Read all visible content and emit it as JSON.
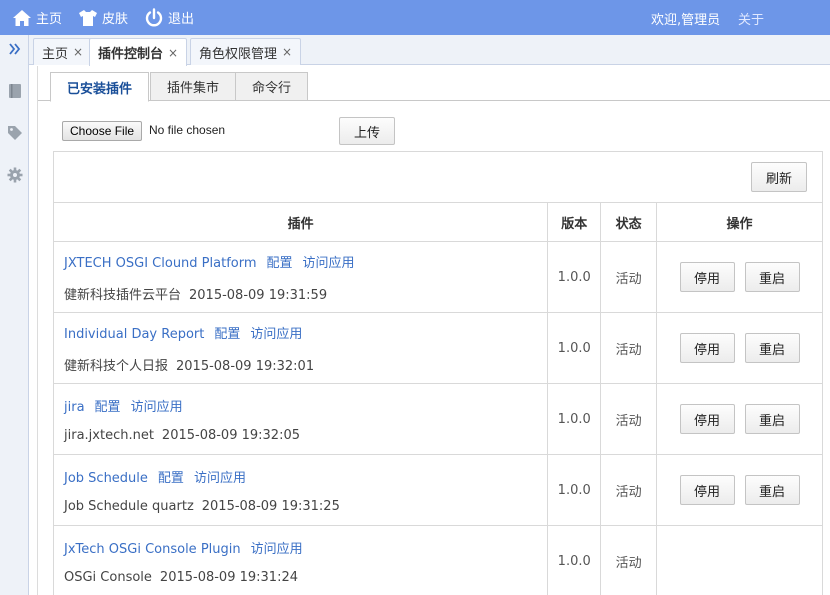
{
  "topbar": {
    "nav": [
      {
        "label": "主页",
        "icon": "home-icon"
      },
      {
        "label": "皮肤",
        "icon": "tshirt-icon"
      },
      {
        "label": "退出",
        "icon": "power-icon"
      }
    ],
    "welcome": "欢迎,管理员",
    "about": "关于",
    "bg_color": "#6d96e8"
  },
  "sidebar": {
    "icons": [
      "expand-chevrons-icon",
      "book-icon",
      "tag-icon",
      "gear-icon"
    ]
  },
  "page_tabs": [
    {
      "label": "主页",
      "close": "×",
      "active": false
    },
    {
      "label": "插件控制台",
      "close": "×",
      "active": true
    },
    {
      "label": "角色权限管理",
      "close": "×",
      "active": false
    }
  ],
  "inner_tabs": [
    {
      "label": "已安装插件",
      "active": true
    },
    {
      "label": "插件集市",
      "active": false
    },
    {
      "label": "命令行",
      "active": false
    }
  ],
  "upload": {
    "choose_label": "Choose File",
    "no_file": "No file chosen",
    "upload_label": "上传"
  },
  "refresh_label": "刷新",
  "table": {
    "headers": {
      "plugin": "插件",
      "version": "版本",
      "status": "状态",
      "ops": "操作"
    },
    "rows": [
      {
        "name": "JXTECH OSGI Clound Platform",
        "links": [
          "配置",
          "访问应用"
        ],
        "desc": "健新科技插件云平台",
        "date": "2015-08-09 19:31:59",
        "version": "1.0.0",
        "status": "活动",
        "ops": [
          "停用",
          "重启"
        ]
      },
      {
        "name": "Individual Day Report",
        "links": [
          "配置",
          "访问应用"
        ],
        "desc": "健新科技个人日报",
        "date": "2015-08-09 19:32:01",
        "version": "1.0.0",
        "status": "活动",
        "ops": [
          "停用",
          "重启"
        ]
      },
      {
        "name": "jira",
        "links": [
          "配置",
          "访问应用"
        ],
        "desc": "jira.jxtech.net",
        "date": "2015-08-09 19:32:05",
        "version": "1.0.0",
        "status": "活动",
        "ops": [
          "停用",
          "重启"
        ]
      },
      {
        "name": "Job Schedule",
        "links": [
          "配置",
          "访问应用"
        ],
        "desc": "Job Schedule quartz",
        "date": "2015-08-09 19:31:25",
        "version": "1.0.0",
        "status": "活动",
        "ops": [
          "停用",
          "重启"
        ]
      },
      {
        "name": "JxTech OSGi Console Plugin",
        "links": [
          "访问应用"
        ],
        "desc": "OSGi Console",
        "date": "2015-08-09 19:31:24",
        "version": "1.0.0",
        "status": "活动",
        "ops": []
      }
    ]
  }
}
